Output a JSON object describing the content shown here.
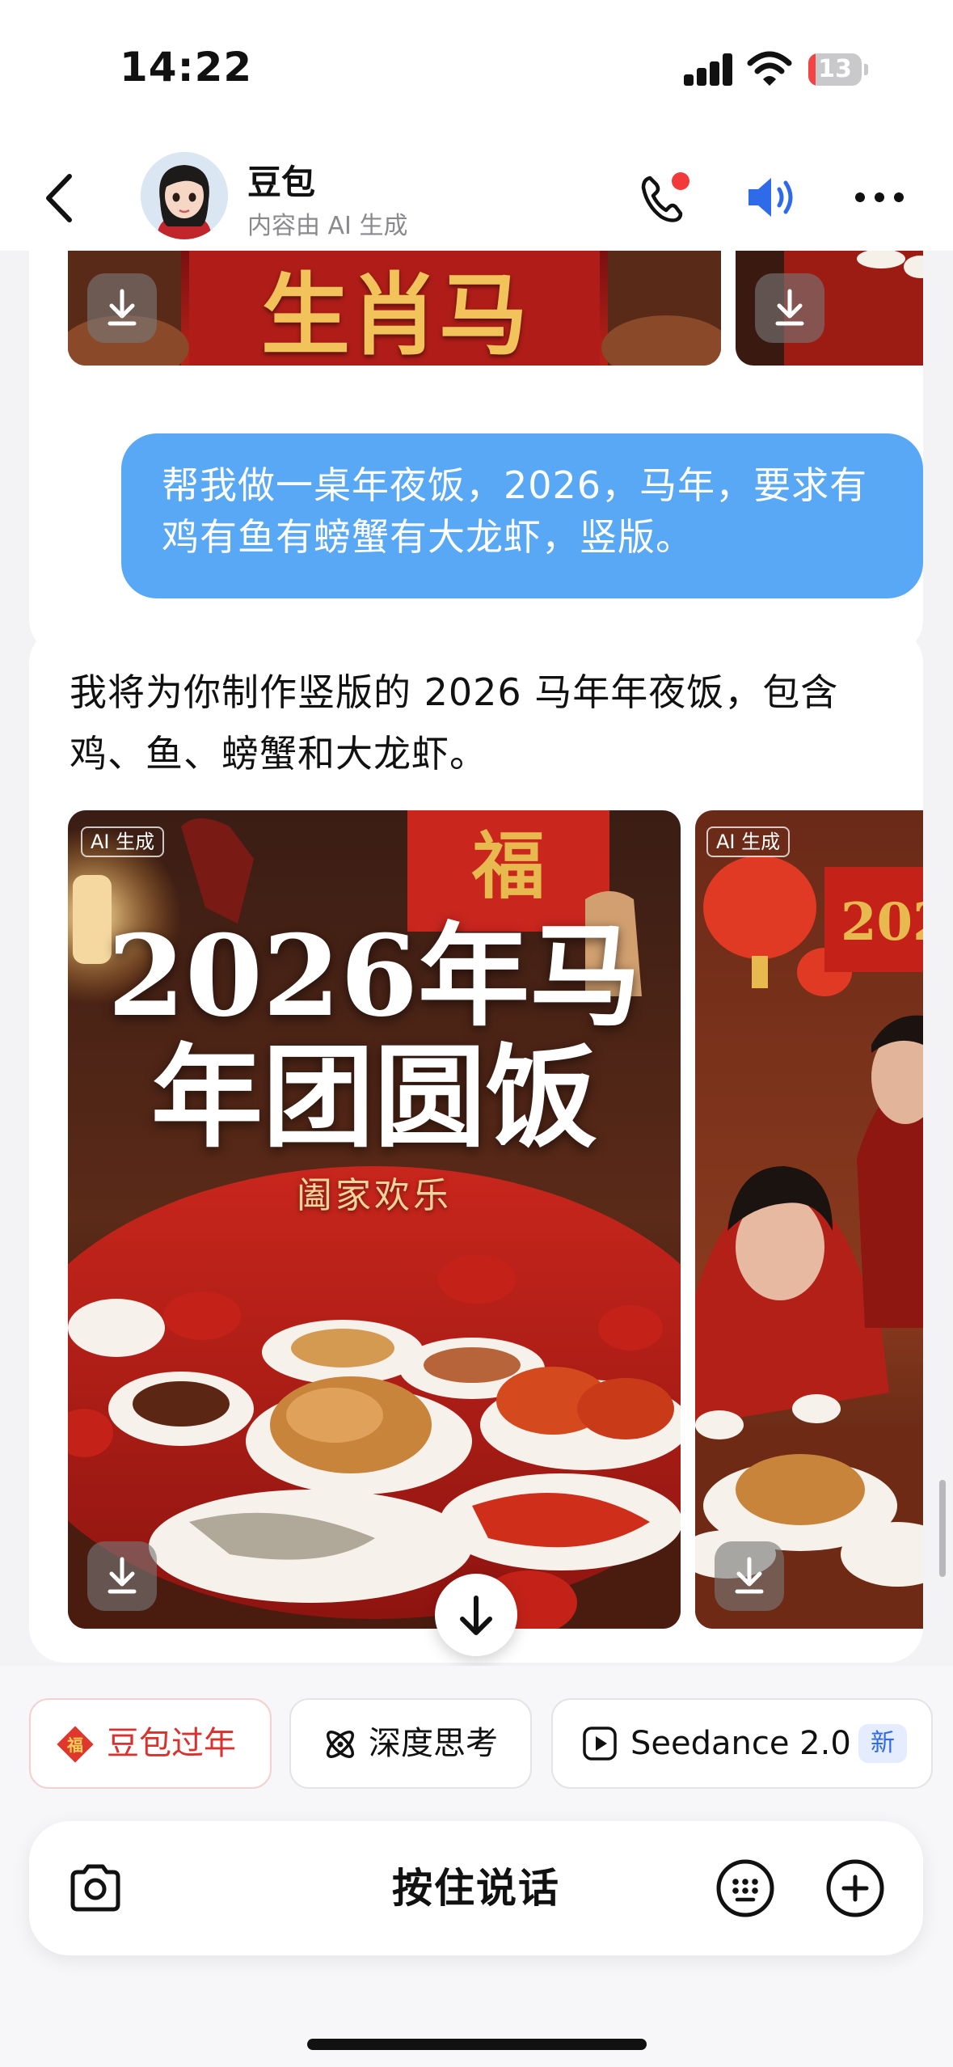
{
  "status": {
    "time": "14:22",
    "battery_level": "13",
    "battery_fraction": 0.13
  },
  "header": {
    "name": "豆包",
    "subtitle": "内容由 AI 生成"
  },
  "chat": {
    "prev_image_text": "生肖马",
    "user_message": "帮我做一桌年夜饭，2026，马年，要求有鸡有鱼有螃蟹有大龙虾，竖版。",
    "ai_reply": "我将为你制作竖版的 2026 马年年夜饭，包含鸡、鱼、螃蟹和大龙虾。",
    "ai_tag": "AI 生成",
    "poster_title": "2026年马年团圆饭",
    "poster_subtitle": "阖家欢乐",
    "poster_fu": "福",
    "poster2_banner": "202"
  },
  "chips": [
    {
      "label": "豆包过年",
      "icon": "fu-diamond-icon"
    },
    {
      "label": "深度思考",
      "icon": "atom-icon"
    },
    {
      "label": "Seedance 2.0",
      "icon": "play-square-icon",
      "badge": "新"
    }
  ],
  "input": {
    "hold_to_talk": "按住说话"
  },
  "colors": {
    "user_bubble": "#58a8f5",
    "accent_red": "#d8322f",
    "call_dot": "#f23a3a",
    "speaker_blue": "#2f6ae8"
  }
}
